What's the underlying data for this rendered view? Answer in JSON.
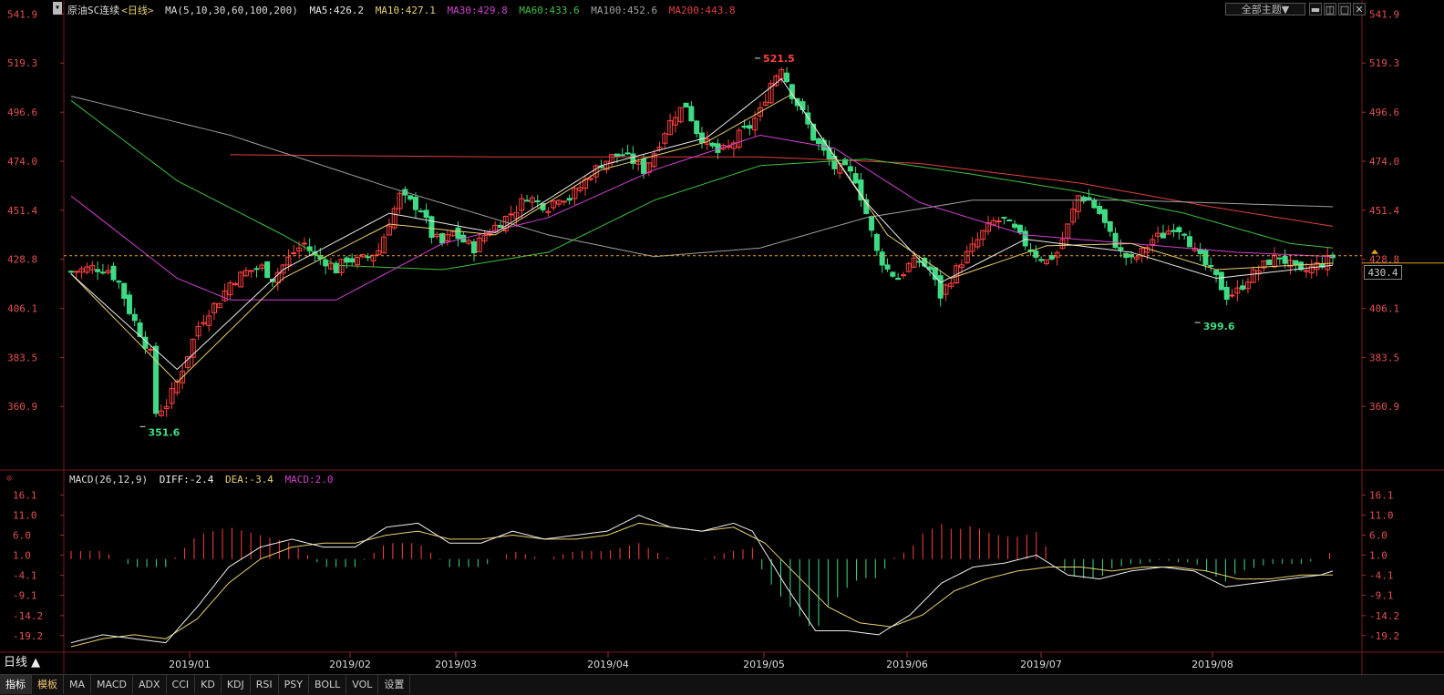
{
  "header": {
    "title": "原油SC连续",
    "period_tag": "<日线>",
    "ma_params": "MA(5,10,30,60,100,200)",
    "ma5": "MA5:426.2",
    "ma10": "MA10:427.1",
    "ma30": "MA30:429.8",
    "ma60": "MA60:433.6",
    "ma100": "MA100:452.6",
    "ma200": "MA200:443.8",
    "theme_button": "全部主题▼"
  },
  "macd_header": {
    "params": "MACD(26,12,9)",
    "diff": "DIFF:-2.4",
    "dea": "DEA:-3.4",
    "macd": "MACD:2.0"
  },
  "current_price": "430.4",
  "period_label": "日线 ▲",
  "tabs": [
    "指标",
    "模板",
    "MA",
    "MACD",
    "ADX",
    "CCI",
    "KD",
    "KDJ",
    "RSI",
    "PSY",
    "BOLL",
    "VOL",
    "设置"
  ],
  "colors": {
    "up": "#ff4040",
    "down": "#3ddc84",
    "ma5": "#e8e8e8",
    "ma10": "#e8d070",
    "ma30": "#d040d0",
    "ma60": "#40c040",
    "ma100": "#a0a0a0",
    "ma200": "#e04040",
    "diff": "#f0f0f0",
    "dea": "#e8d070"
  },
  "chart_data": [
    {
      "type": "candlestick",
      "title": "原油SC连续",
      "x_labels": [
        "2019/01",
        "2019/02",
        "2019/03",
        "2019/04",
        "2019/05",
        "2019/06",
        "2019/07",
        "2019/08"
      ],
      "y_ticks": [
        541.9,
        519.3,
        496.6,
        474.0,
        451.4,
        428.8,
        406.1,
        383.5,
        360.9
      ],
      "ylim": [
        338.3,
        545
      ],
      "annotations": [
        {
          "label": "521.5",
          "value": 521.5
        },
        {
          "label": "351.6",
          "value": 351.6
        },
        {
          "label": "399.6",
          "value": 399.6
        }
      ],
      "close_path": [
        [
          0,
          423
        ],
        [
          4,
          425
        ],
        [
          7,
          424
        ],
        [
          9,
          418
        ],
        [
          11,
          405
        ],
        [
          13,
          395
        ],
        [
          15,
          385
        ],
        [
          16,
          358
        ],
        [
          18,
          362
        ],
        [
          20,
          372
        ],
        [
          22,
          385
        ],
        [
          24,
          398
        ],
        [
          26,
          405
        ],
        [
          28,
          410
        ],
        [
          30,
          418
        ],
        [
          33,
          423
        ],
        [
          36,
          425
        ],
        [
          38,
          420
        ],
        [
          40,
          426
        ],
        [
          42,
          432
        ],
        [
          44,
          436
        ],
        [
          46,
          430
        ],
        [
          48,
          428
        ],
        [
          50,
          424
        ],
        [
          52,
          429
        ],
        [
          54,
          428
        ],
        [
          56,
          430
        ],
        [
          58,
          433
        ],
        [
          60,
          446
        ],
        [
          62,
          458
        ],
        [
          64,
          455
        ],
        [
          66,
          452
        ],
        [
          68,
          440
        ],
        [
          70,
          436
        ],
        [
          72,
          441
        ],
        [
          74,
          437
        ],
        [
          76,
          434
        ],
        [
          78,
          440
        ],
        [
          80,
          444
        ],
        [
          82,
          448
        ],
        [
          84,
          452
        ],
        [
          86,
          458
        ],
        [
          88,
          455
        ],
        [
          90,
          453
        ],
        [
          92,
          458
        ],
        [
          94,
          457
        ],
        [
          96,
          462
        ],
        [
          98,
          468
        ],
        [
          100,
          473
        ],
        [
          102,
          476
        ],
        [
          104,
          477
        ],
        [
          106,
          474
        ],
        [
          108,
          470
        ],
        [
          110,
          478
        ],
        [
          112,
          488
        ],
        [
          114,
          496
        ],
        [
          116,
          500
        ],
        [
          118,
          488
        ],
        [
          120,
          482
        ],
        [
          122,
          478
        ],
        [
          124,
          480
        ],
        [
          126,
          486
        ],
        [
          128,
          490
        ],
        [
          130,
          497
        ],
        [
          132,
          510
        ],
        [
          134,
          518
        ],
        [
          136,
          505
        ],
        [
          138,
          496
        ],
        [
          140,
          485
        ],
        [
          142,
          478
        ],
        [
          144,
          471
        ],
        [
          146,
          470
        ],
        [
          148,
          466
        ],
        [
          150,
          450
        ],
        [
          152,
          432
        ],
        [
          154,
          424
        ],
        [
          156,
          420
        ],
        [
          158,
          426
        ],
        [
          160,
          428
        ],
        [
          162,
          424
        ],
        [
          164,
          412
        ],
        [
          166,
          420
        ],
        [
          168,
          428
        ],
        [
          170,
          434
        ],
        [
          172,
          441
        ],
        [
          174,
          446
        ],
        [
          176,
          447
        ],
        [
          178,
          442
        ],
        [
          180,
          436
        ],
        [
          182,
          431
        ],
        [
          184,
          428
        ],
        [
          186,
          432
        ],
        [
          188,
          444
        ],
        [
          190,
          458
        ],
        [
          192,
          456
        ],
        [
          194,
          450
        ],
        [
          196,
          440
        ],
        [
          198,
          432
        ],
        [
          200,
          428
        ],
        [
          202,
          432
        ],
        [
          204,
          438
        ],
        [
          206,
          440
        ],
        [
          208,
          444
        ],
        [
          210,
          442
        ],
        [
          212,
          432
        ],
        [
          214,
          426
        ],
        [
          216,
          420
        ],
        [
          218,
          412
        ],
        [
          220,
          414
        ],
        [
          222,
          420
        ],
        [
          224,
          424
        ],
        [
          226,
          428
        ],
        [
          228,
          430
        ],
        [
          230,
          426
        ],
        [
          232,
          422
        ],
        [
          234,
          425
        ],
        [
          236,
          427
        ],
        [
          238,
          430
        ]
      ],
      "ma_lines": {
        "ma5": [
          [
            0,
            422
          ],
          [
            20,
            378
          ],
          [
            40,
            424
          ],
          [
            60,
            450
          ],
          [
            80,
            441
          ],
          [
            100,
            472
          ],
          [
            120,
            485
          ],
          [
            134,
            512
          ],
          [
            150,
            455
          ],
          [
            164,
            418
          ],
          [
            180,
            438
          ],
          [
            200,
            432
          ],
          [
            216,
            420
          ],
          [
            238,
            426
          ]
        ],
        "ma10": [
          [
            0,
            422
          ],
          [
            20,
            372
          ],
          [
            40,
            420
          ],
          [
            60,
            445
          ],
          [
            80,
            440
          ],
          [
            100,
            470
          ],
          [
            120,
            483
          ],
          [
            136,
            505
          ],
          [
            154,
            440
          ],
          [
            166,
            420
          ],
          [
            184,
            435
          ],
          [
            200,
            436
          ],
          [
            216,
            424
          ],
          [
            238,
            427
          ]
        ],
        "ma30": [
          [
            0,
            458
          ],
          [
            20,
            420
          ],
          [
            30,
            410
          ],
          [
            50,
            410
          ],
          [
            70,
            436
          ],
          [
            90,
            448
          ],
          [
            110,
            470
          ],
          [
            130,
            486
          ],
          [
            144,
            480
          ],
          [
            160,
            455
          ],
          [
            180,
            440
          ],
          [
            200,
            436
          ],
          [
            220,
            432
          ],
          [
            238,
            430
          ]
        ],
        "ma60": [
          [
            0,
            502
          ],
          [
            20,
            465
          ],
          [
            40,
            440
          ],
          [
            50,
            426
          ],
          [
            70,
            424
          ],
          [
            90,
            432
          ],
          [
            110,
            456
          ],
          [
            130,
            472
          ],
          [
            150,
            475
          ],
          [
            170,
            468
          ],
          [
            190,
            460
          ],
          [
            210,
            450
          ],
          [
            230,
            436
          ],
          [
            238,
            434
          ]
        ],
        "ma100": [
          [
            0,
            504
          ],
          [
            30,
            486
          ],
          [
            60,
            462
          ],
          [
            90,
            440
          ],
          [
            110,
            430
          ],
          [
            130,
            434
          ],
          [
            150,
            448
          ],
          [
            170,
            456
          ],
          [
            200,
            456
          ],
          [
            238,
            453
          ]
        ],
        "ma200": [
          [
            30,
            477
          ],
          [
            80,
            476
          ],
          [
            130,
            476
          ],
          [
            160,
            473
          ],
          [
            190,
            464
          ],
          [
            215,
            453
          ],
          [
            238,
            444
          ]
        ]
      },
      "last_price_line": 430.4
    },
    {
      "type": "macd",
      "title": "MACD(26,12,9)",
      "y_ticks": [
        16.1,
        11.0,
        6.0,
        1.0,
        -4.1,
        -9.1,
        -14.2,
        -19.2
      ],
      "ylim": [
        -22,
        18
      ],
      "diff": [
        [
          0,
          -21
        ],
        [
          10,
          -19
        ],
        [
          20,
          -20
        ],
        [
          30,
          -21
        ],
        [
          40,
          -12
        ],
        [
          50,
          -2
        ],
        [
          60,
          3
        ],
        [
          70,
          5
        ],
        [
          80,
          3
        ],
        [
          90,
          3
        ],
        [
          100,
          8
        ],
        [
          110,
          9
        ],
        [
          120,
          4
        ],
        [
          130,
          4
        ],
        [
          140,
          7
        ],
        [
          150,
          5
        ],
        [
          160,
          6
        ],
        [
          170,
          7
        ],
        [
          180,
          11
        ],
        [
          190,
          8
        ],
        [
          200,
          7
        ],
        [
          210,
          9
        ],
        [
          216,
          7
        ],
        [
          226,
          -6
        ],
        [
          236,
          -18
        ],
        [
          246,
          -18
        ],
        [
          256,
          -19
        ],
        [
          266,
          -14
        ],
        [
          276,
          -6
        ],
        [
          286,
          -2
        ],
        [
          296,
          -1
        ],
        [
          306,
          1
        ],
        [
          316,
          -4
        ],
        [
          326,
          -5
        ],
        [
          336,
          -3
        ],
        [
          346,
          -2
        ],
        [
          356,
          -3
        ],
        [
          366,
          -7
        ],
        [
          376,
          -6
        ],
        [
          386,
          -5
        ],
        [
          396,
          -4
        ],
        [
          400,
          -3
        ]
      ],
      "dea": [
        [
          0,
          -22
        ],
        [
          10,
          -20
        ],
        [
          20,
          -19
        ],
        [
          30,
          -20
        ],
        [
          40,
          -15
        ],
        [
          50,
          -6
        ],
        [
          60,
          0
        ],
        [
          70,
          3
        ],
        [
          80,
          4
        ],
        [
          90,
          4
        ],
        [
          100,
          6
        ],
        [
          110,
          7
        ],
        [
          120,
          5
        ],
        [
          130,
          5
        ],
        [
          140,
          6
        ],
        [
          150,
          5
        ],
        [
          160,
          5
        ],
        [
          170,
          6
        ],
        [
          180,
          9
        ],
        [
          190,
          8
        ],
        [
          200,
          7
        ],
        [
          210,
          8
        ],
        [
          220,
          4
        ],
        [
          230,
          -4
        ],
        [
          240,
          -12
        ],
        [
          250,
          -16
        ],
        [
          260,
          -17
        ],
        [
          270,
          -14
        ],
        [
          280,
          -8
        ],
        [
          290,
          -5
        ],
        [
          300,
          -3
        ],
        [
          310,
          -2
        ],
        [
          320,
          -2
        ],
        [
          330,
          -3
        ],
        [
          340,
          -2
        ],
        [
          350,
          -2
        ],
        [
          360,
          -3
        ],
        [
          370,
          -5
        ],
        [
          380,
          -5
        ],
        [
          390,
          -4
        ],
        [
          400,
          -4
        ]
      ]
    }
  ]
}
